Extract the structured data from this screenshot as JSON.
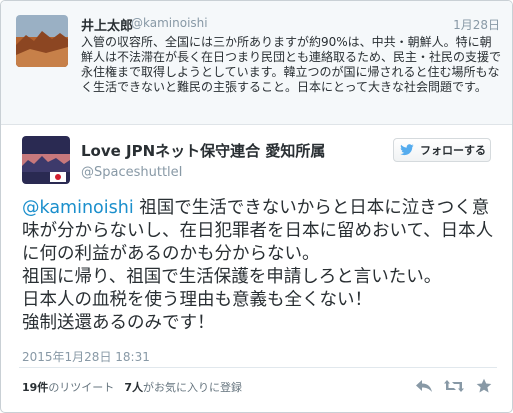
{
  "parent_tweet": {
    "name": "井上太郎",
    "handle": "@kaminoishi",
    "date": "1月28日",
    "text": "入管の収容所、全国には三か所ありますが約90%は、中共・朝鮮人。特に朝鮮人は不法滞在が長く在日つまり民団とも連絡取るため、民主・社民の支援で永住権まで取得しようとしています。韓立つのが国に帰されると住む場所もなく生活できないと難民の主張すること。日本にとって大きな社会問題です。"
  },
  "main_tweet": {
    "name": "Love JPNネット保守連合 愛知所属",
    "handle": "@SpaceshuttleI",
    "follow_label": "フォローする",
    "mention": "@kaminoishi",
    "text_after_mention": " 祖国で生活できないからと日本に泣きつく意味が分からないし、在日犯罪者を日本に留めおいて、日本人に何の利益があるのかも分からない。",
    "lines": [
      "祖国に帰り、祖国で生活保護を申請しろと言いたい。",
      "日本人の血税を使う理由も意義も全くない！",
      "強制送還あるのみです！"
    ],
    "timestamp": "2015年1月28日 18:31"
  },
  "stats": {
    "retweets_count": "19件",
    "retweets_label": "のリツイート",
    "favorites_count": "7人",
    "favorites_label": "がお気に入りに登録"
  },
  "icons": [
    "bird-icon",
    "reply-icon",
    "retweet-icon",
    "favorite-icon"
  ],
  "colors": {
    "link": "#1b8fcc",
    "twitter_blue": "#55acee",
    "muted": "#8899a6"
  }
}
